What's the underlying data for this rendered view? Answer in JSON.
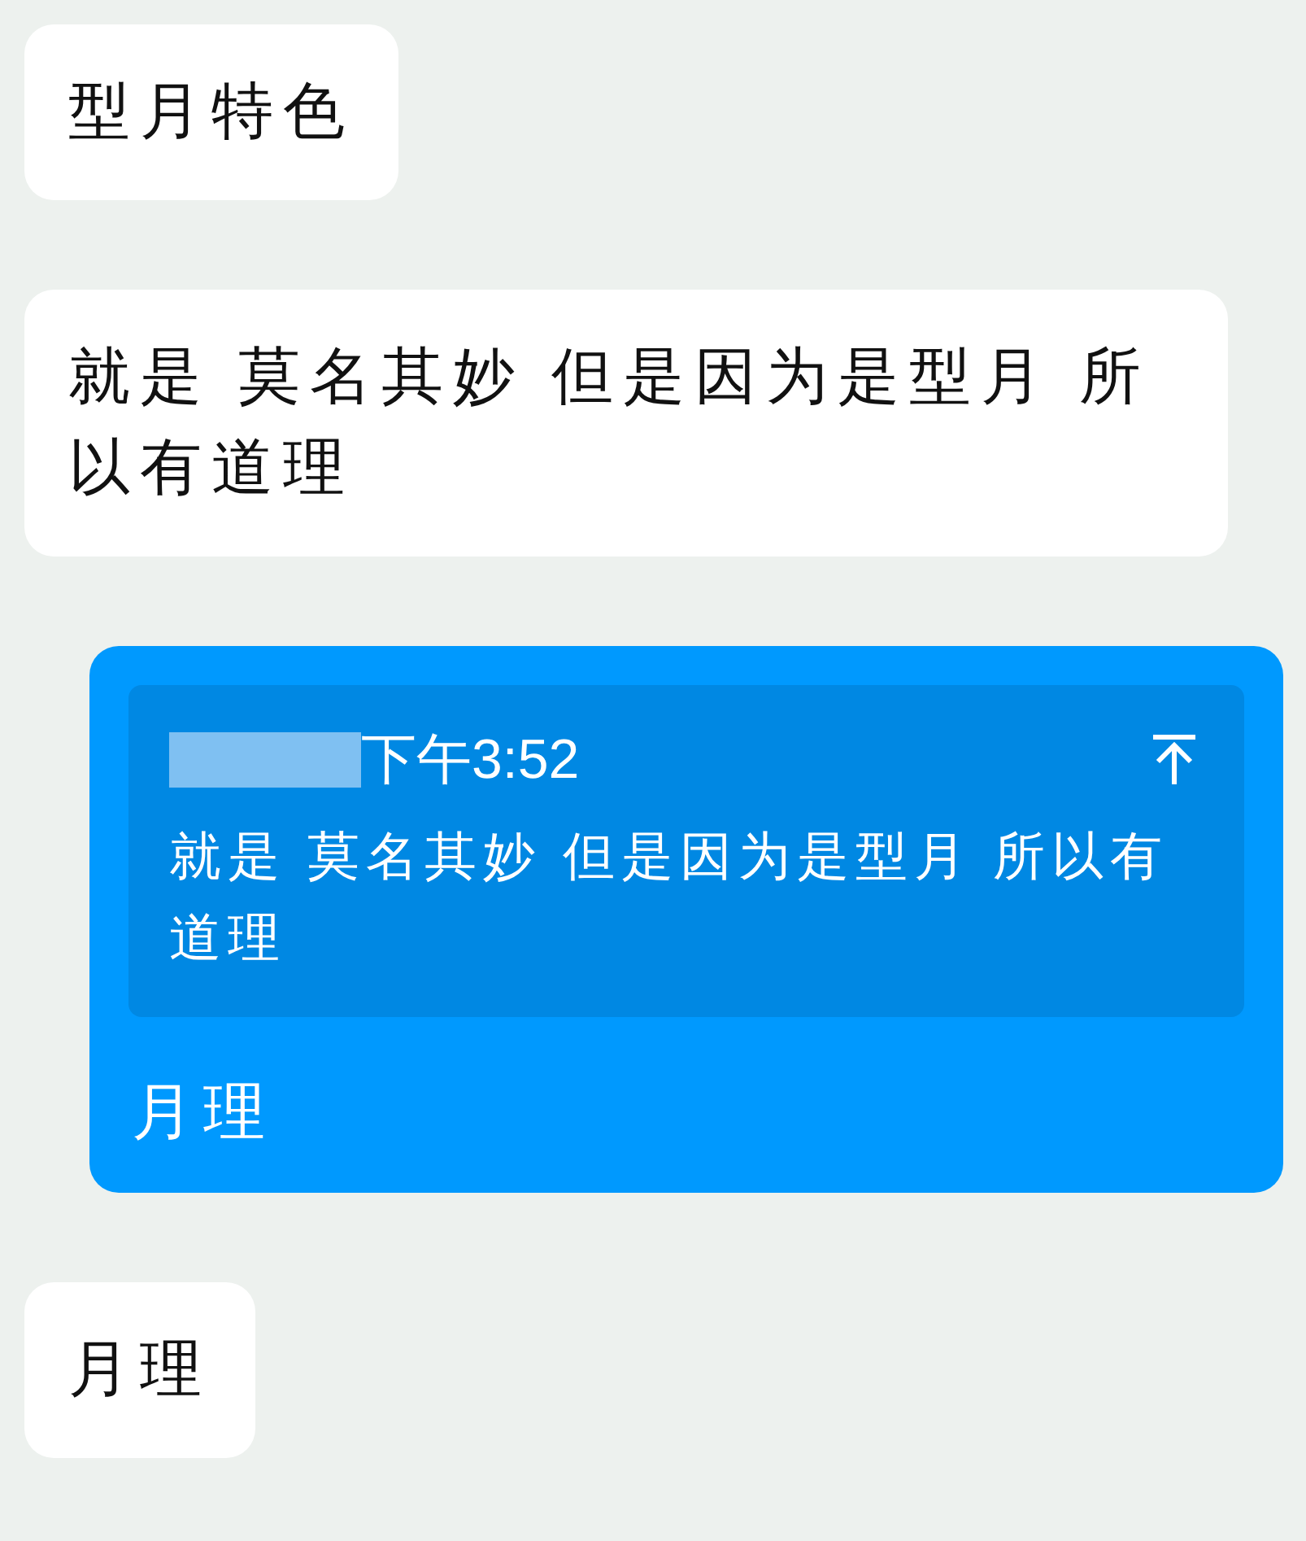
{
  "messages": [
    {
      "kind": "text",
      "text": "型月特色"
    },
    {
      "kind": "text",
      "text": "就是 莫名其妙 但是因为是型月 所以有道理"
    },
    {
      "kind": "reply",
      "quote": {
        "time": "下午3:52",
        "text": "就是 莫名其妙 但是因为是型月 所以有道理"
      },
      "text": "月理"
    },
    {
      "kind": "text",
      "text": "月理"
    }
  ]
}
